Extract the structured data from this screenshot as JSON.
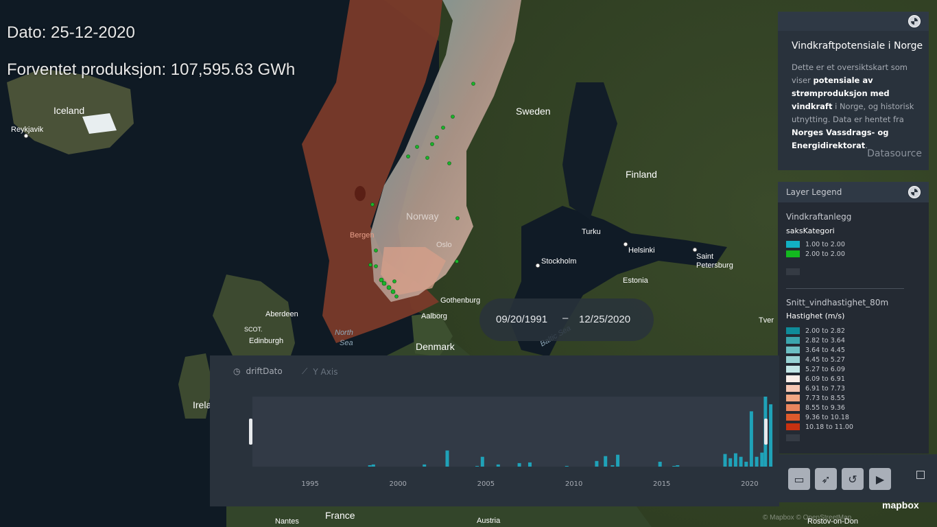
{
  "header": {
    "date_line": "Dato: 25-12-2020",
    "production_line": "Forventet produksjon: 107,595.63 GWh"
  },
  "map_labels": {
    "iceland": "Iceland",
    "reykjavik": "Reykjavik",
    "sweden": "Sweden",
    "finland": "Finland",
    "norway": "Norway",
    "bergen": "Bergen",
    "oslo": "Oslo",
    "turku": "Turku",
    "helsinki": "Helsinki",
    "saint_petersburg_1": "Saint",
    "saint_petersburg_2": "Petersburg",
    "stockholm": "Stockholm",
    "estonia": "Estonia",
    "gothenburg": "Gothenburg",
    "aalborg": "Aalborg",
    "aberdeen": "Aberdeen",
    "scot": "SCOT.",
    "edinburgh": "Edinburgh",
    "north_sea_1": "North",
    "north_sea_2": "Sea",
    "denmark": "Denmark",
    "tver": "Tver",
    "baltic_sea": "Baltic Sea",
    "ireland_partial": "Irela",
    "france": "France",
    "nantes": "Nantes",
    "austria": "Austria",
    "rostov": "Rostov-on-Don"
  },
  "info_panel": {
    "title": "Vindkraftpotensiale i Norge",
    "body_1": "Dette er et oversiktskart som viser ",
    "body_bold_1": "potensiale av strømproduksjon med vindkraft",
    "body_2": " i Norge, og historisk utnytting. Data er hentet fra ",
    "body_bold_2": "Norges Vassdrags- og Energidirektorat",
    "body_3": ".",
    "datasource_link": "Datasource"
  },
  "legend": {
    "title": "Layer Legend",
    "layers": [
      {
        "name": "Vindkraftanlegg",
        "field": "saksKategori",
        "items": [
          {
            "label": "1.00 to 2.00",
            "color": "#12b0c4"
          },
          {
            "label": "2.00 to 2.00",
            "color": "#13b81f"
          }
        ]
      },
      {
        "name": "Snitt_vindhastighet_80m",
        "field": "Hastighet (m/s)",
        "items": [
          {
            "label": "2.00 to 2.82",
            "color": "#0f8b99"
          },
          {
            "label": "2.82 to 3.64",
            "color": "#3ba5ad"
          },
          {
            "label": "3.64 to 4.45",
            "color": "#6cbfc3"
          },
          {
            "label": "4.45 to 5.27",
            "color": "#98d2d4"
          },
          {
            "label": "5.27 to 6.09",
            "color": "#c3e6e6"
          },
          {
            "label": "6.09 to 6.91",
            "color": "#fbeee8"
          },
          {
            "label": "6.91 to 7.73",
            "color": "#f6c6b2"
          },
          {
            "label": "7.73 to 8.55",
            "color": "#f2a783"
          },
          {
            "label": "8.55 to 9.36",
            "color": "#e9855d"
          },
          {
            "label": "9.36 to 10.18",
            "color": "#dd5a2c"
          },
          {
            "label": "10.18 to 11.00",
            "color": "#c73110"
          }
        ]
      }
    ]
  },
  "date_range": {
    "start": "09/20/1991",
    "separator": "–",
    "end": "12/25/2020"
  },
  "timeline": {
    "field_label": "driftDato",
    "yaxis_label": "Y Axis",
    "bar_color": "#1fa2b8",
    "x_ticks": [
      "1995",
      "2000",
      "2005",
      "2010",
      "2015",
      "2020"
    ]
  },
  "chart_data": {
    "type": "bar",
    "xlabel": "",
    "ylabel": "",
    "x_range": [
      1991.72,
      2020.98
    ],
    "bars": [
      {
        "x": 1998.4,
        "y": 2
      },
      {
        "x": 1998.6,
        "y": 3
      },
      {
        "x": 2001.5,
        "y": 3
      },
      {
        "x": 2002.8,
        "y": 23
      },
      {
        "x": 2004.5,
        "y": 1
      },
      {
        "x": 2004.8,
        "y": 14
      },
      {
        "x": 2005.7,
        "y": 3
      },
      {
        "x": 2006.9,
        "y": 5
      },
      {
        "x": 2007.5,
        "y": 6
      },
      {
        "x": 2009.6,
        "y": 1
      },
      {
        "x": 2011.3,
        "y": 8
      },
      {
        "x": 2011.8,
        "y": 15
      },
      {
        "x": 2012.2,
        "y": 2
      },
      {
        "x": 2012.5,
        "y": 17
      },
      {
        "x": 2014.9,
        "y": 7
      },
      {
        "x": 2015.7,
        "y": 1
      },
      {
        "x": 2015.9,
        "y": 2
      },
      {
        "x": 2018.6,
        "y": 18
      },
      {
        "x": 2018.9,
        "y": 12
      },
      {
        "x": 2019.2,
        "y": 19
      },
      {
        "x": 2019.5,
        "y": 14
      },
      {
        "x": 2019.8,
        "y": 7
      },
      {
        "x": 2020.1,
        "y": 79
      },
      {
        "x": 2020.4,
        "y": 14
      },
      {
        "x": 2020.7,
        "y": 20
      },
      {
        "x": 2020.9,
        "y": 100
      },
      {
        "x": 2021.2,
        "y": 89
      }
    ],
    "x_ticks": [
      1995,
      2000,
      2005,
      2010,
      2015,
      2020
    ]
  },
  "attribution": "© Mapbox © OpenStreetMap",
  "mapbox_logo": "mapbox"
}
